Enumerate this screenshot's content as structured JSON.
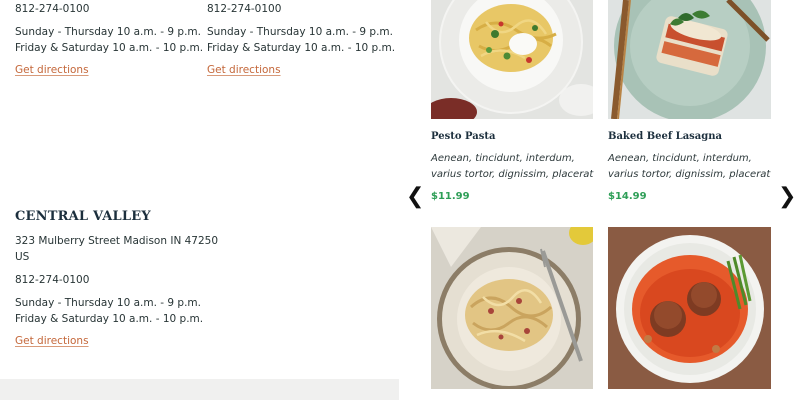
{
  "locations": [
    {
      "phone": "812-274-0100",
      "hours_1": "Sunday - Thursday 10 a.m. - 9 p.m.",
      "hours_2": "Friday & Saturday 10 a.m. - 10 p.m.",
      "directions": "Get directions"
    },
    {
      "phone": "812-274-0100",
      "hours_1": "Sunday - Thursday 10 a.m. - 9 p.m.",
      "hours_2": "Friday & Saturday 10 a.m. - 10 p.m.",
      "directions": "Get directions"
    },
    {
      "name": "CENTRAL VALLEY",
      "address_1": "323 Mulberry Street Madison IN 47250",
      "address_2": "US",
      "phone": "812-274-0100",
      "hours_1": "Sunday - Thursday 10 a.m. - 9 p.m.",
      "hours_2": "Friday & Saturday 10 a.m. - 10 p.m.",
      "directions": "Get directions"
    }
  ],
  "menu": {
    "prev_icon": "chevron-left-icon",
    "next_icon": "chevron-right-icon",
    "prev_glyph": "❮",
    "next_glyph": "❯",
    "items": [
      {
        "name": "Pesto Pasta",
        "description": "Aenean, tincidunt, interdum, varius tortor, dignissim, placerat",
        "price": "$11.99"
      },
      {
        "name": "Baked Beef Lasagna",
        "description": "Aenean, tincidunt, interdum, varius tortor, dignissim, placerat",
        "price": "$14.99"
      }
    ]
  },
  "colors": {
    "link": "#c4673a",
    "price": "#2e9e57",
    "heading": "#1c2f3d",
    "band": "#f0f0ef"
  }
}
